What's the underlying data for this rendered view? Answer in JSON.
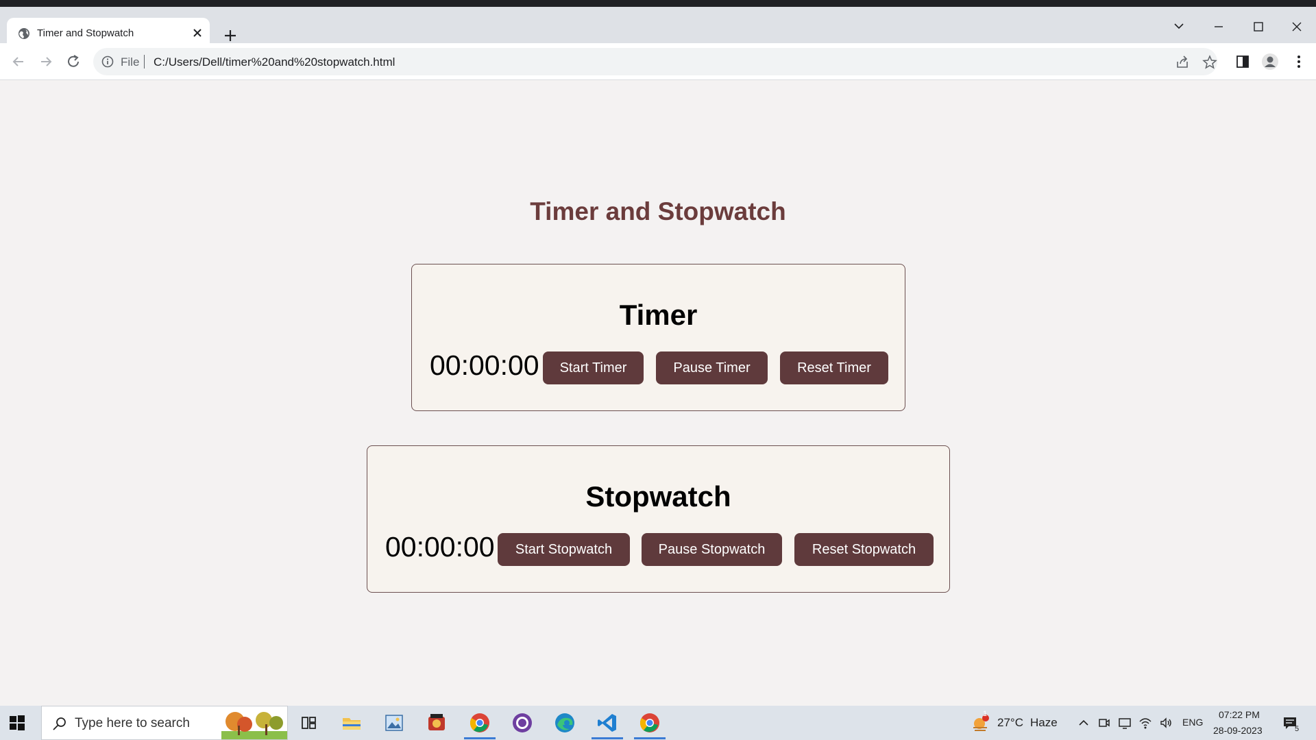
{
  "browser": {
    "tab": {
      "title": "Timer and Stopwatch"
    },
    "address_bar": {
      "scheme_label": "File",
      "url": "C:/Users/Dell/timer%20and%20stopwatch.html"
    }
  },
  "page": {
    "heading": "Timer and Stopwatch",
    "timer": {
      "title": "Timer",
      "display": "00:00:00",
      "buttons": {
        "start": "Start Timer",
        "pause": "Pause Timer",
        "reset": "Reset Timer"
      }
    },
    "stopwatch": {
      "title": "Stopwatch",
      "display": "00:00:00",
      "buttons": {
        "start": "Start Stopwatch",
        "pause": "Pause Stopwatch",
        "reset": "Reset Stopwatch"
      }
    }
  },
  "taskbar": {
    "search_placeholder": "Type here to search",
    "weather": {
      "temp": "27°C",
      "condition": "Haze",
      "alert_count": "1"
    },
    "language": "ENG",
    "time": "07:22 PM",
    "date": "28-09-2023",
    "notification_count": "5",
    "apps": [
      "task-view-icon",
      "file-explorer-icon",
      "photos-icon",
      "media-app-icon",
      "chrome-profile-icon",
      "github-desktop-icon",
      "edge-icon",
      "vscode-icon",
      "chrome-icon"
    ]
  },
  "colors": {
    "accent": "#5f3a3c",
    "heading": "#6b3c3c",
    "card_bg": "#f7f3ee",
    "page_bg": "#f4f2f2"
  }
}
